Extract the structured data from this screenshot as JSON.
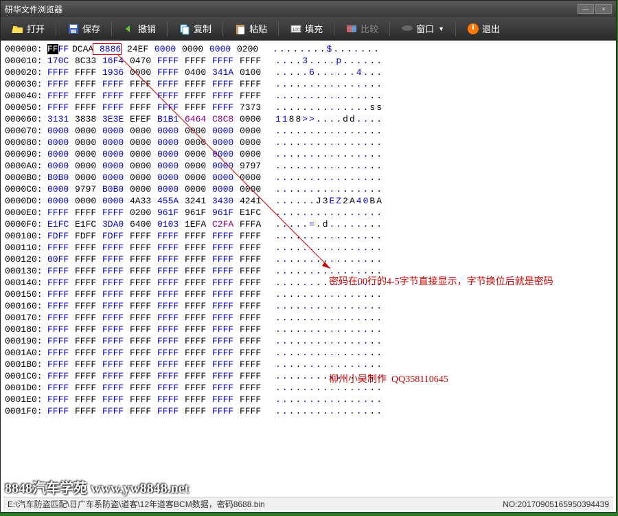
{
  "title": "研华文件浏览器",
  "toolbar": {
    "open": "打开",
    "save": "保存",
    "undo": "撤销",
    "copy": "复制",
    "paste": "粘贴",
    "fill": "填充",
    "compare": "比较",
    "window": "窗口",
    "exit": "退出"
  },
  "hex_rows": [
    {
      "addr": "000000:",
      "bytes": [
        "FFFF",
        "DCAA",
        "8886",
        "24EF",
        "0000",
        "0000",
        "0000",
        "0200"
      ],
      "ascii": "........$......."
    },
    {
      "addr": "000010:",
      "bytes": [
        "170C",
        "8C33",
        "16F4",
        "0470",
        "FFFF",
        "FFFF",
        "FFFF",
        "FFFF"
      ],
      "ascii": "....3....p......"
    },
    {
      "addr": "000020:",
      "bytes": [
        "FFFF",
        "FFFF",
        "1936",
        "0000",
        "FFFF",
        "0400",
        "341A",
        "0100"
      ],
      "ascii": ".....6......4..."
    },
    {
      "addr": "000030:",
      "bytes": [
        "FFFF",
        "FFFF",
        "FFFF",
        "FFFF",
        "FFFF",
        "FFFF",
        "FFFF",
        "FFFF"
      ],
      "ascii": "................"
    },
    {
      "addr": "000040:",
      "bytes": [
        "FFFF",
        "FFFF",
        "FFFF",
        "FFFF",
        "FFFF",
        "FFFF",
        "FFFF",
        "FFFF"
      ],
      "ascii": "................"
    },
    {
      "addr": "000050:",
      "bytes": [
        "FFFF",
        "FFFF",
        "FFFF",
        "FFFF",
        "FFFF",
        "FFFF",
        "FFFF",
        "7373"
      ],
      "ascii": "..............ss"
    },
    {
      "addr": "000060:",
      "bytes": [
        "3131",
        "3838",
        "3E3E",
        "EFEF",
        "B1B1",
        "6464",
        "C8C8",
        "0000"
      ],
      "ascii": "1188>>....dd...."
    },
    {
      "addr": "000070:",
      "bytes": [
        "0000",
        "0000",
        "0000",
        "0000",
        "0000",
        "0000",
        "0000",
        "0000"
      ],
      "ascii": "................"
    },
    {
      "addr": "000080:",
      "bytes": [
        "0000",
        "0000",
        "0000",
        "0000",
        "0000",
        "0000",
        "0000",
        "0000"
      ],
      "ascii": "................"
    },
    {
      "addr": "000090:",
      "bytes": [
        "0000",
        "0000",
        "0000",
        "0000",
        "0000",
        "0000",
        "0000",
        "0000"
      ],
      "ascii": "................"
    },
    {
      "addr": "0000A0:",
      "bytes": [
        "0000",
        "0000",
        "0000",
        "0000",
        "0000",
        "0000",
        "0000",
        "9797"
      ],
      "ascii": "................"
    },
    {
      "addr": "0000B0:",
      "bytes": [
        "B0B0",
        "0000",
        "0000",
        "0000",
        "0000",
        "0000",
        "0000",
        "0000"
      ],
      "ascii": "................"
    },
    {
      "addr": "0000C0:",
      "bytes": [
        "0000",
        "9797",
        "B0B0",
        "0000",
        "0000",
        "0000",
        "0000",
        "0000"
      ],
      "ascii": "................"
    },
    {
      "addr": "0000D0:",
      "bytes": [
        "0000",
        "0000",
        "0000",
        "4A33",
        "455A",
        "3241",
        "3430",
        "4241"
      ],
      "ascii": "......J3EZ2A40BA"
    },
    {
      "addr": "0000E0:",
      "bytes": [
        "FFFF",
        "FFFF",
        "FFFF",
        "0200",
        "961F",
        "961F",
        "961F",
        "E1FC"
      ],
      "ascii": "................"
    },
    {
      "addr": "0000F0:",
      "bytes": [
        "E1FC",
        "E1FC",
        "3DA0",
        "6400",
        "0103",
        "1EFA",
        "C2FA",
        "FFFA"
      ],
      "ascii": ".....=.d........"
    },
    {
      "addr": "000100:",
      "bytes": [
        "FDFF",
        "FDFF",
        "FDFF",
        "FFFF",
        "FFFF",
        "FFFF",
        "FFFF",
        "FFFF"
      ],
      "ascii": "................"
    },
    {
      "addr": "000110:",
      "bytes": [
        "FFFF",
        "FFFF",
        "FFFF",
        "FFFF",
        "FFFF",
        "FFFF",
        "FFFF",
        "FFFF"
      ],
      "ascii": "................"
    },
    {
      "addr": "000120:",
      "bytes": [
        "00FF",
        "FFFF",
        "FFFF",
        "FFFF",
        "FFFF",
        "FFFF",
        "FFFF",
        "FFFF"
      ],
      "ascii": "................"
    },
    {
      "addr": "000130:",
      "bytes": [
        "FFFF",
        "FFFF",
        "FFFF",
        "FFFF",
        "FFFF",
        "FFFF",
        "FFFF",
        "FFFF"
      ],
      "ascii": "................"
    },
    {
      "addr": "000140:",
      "bytes": [
        "FFFF",
        "FFFF",
        "FFFF",
        "FFFF",
        "FFFF",
        "FFFF",
        "FFFF",
        "FFFF"
      ],
      "ascii": "................"
    },
    {
      "addr": "000150:",
      "bytes": [
        "FFFF",
        "FFFF",
        "FFFF",
        "FFFF",
        "FFFF",
        "FFFF",
        "FFFF",
        "FFFF"
      ],
      "ascii": "................"
    },
    {
      "addr": "000160:",
      "bytes": [
        "FFFF",
        "FFFF",
        "FFFF",
        "FFFF",
        "FFFF",
        "FFFF",
        "FFFF",
        "FFFF"
      ],
      "ascii": "................"
    },
    {
      "addr": "000170:",
      "bytes": [
        "FFFF",
        "FFFF",
        "FFFF",
        "FFFF",
        "FFFF",
        "FFFF",
        "FFFF",
        "FFFF"
      ],
      "ascii": "................"
    },
    {
      "addr": "000180:",
      "bytes": [
        "FFFF",
        "FFFF",
        "FFFF",
        "FFFF",
        "FFFF",
        "FFFF",
        "FFFF",
        "FFFF"
      ],
      "ascii": "................"
    },
    {
      "addr": "000190:",
      "bytes": [
        "FFFF",
        "FFFF",
        "FFFF",
        "FFFF",
        "FFFF",
        "FFFF",
        "FFFF",
        "FFFF"
      ],
      "ascii": "................"
    },
    {
      "addr": "0001A0:",
      "bytes": [
        "FFFF",
        "FFFF",
        "FFFF",
        "FFFF",
        "FFFF",
        "FFFF",
        "FFFF",
        "FFFF"
      ],
      "ascii": "................"
    },
    {
      "addr": "0001B0:",
      "bytes": [
        "FFFF",
        "FFFF",
        "FFFF",
        "FFFF",
        "FFFF",
        "FFFF",
        "FFFF",
        "FFFF"
      ],
      "ascii": "................"
    },
    {
      "addr": "0001C0:",
      "bytes": [
        "FFFF",
        "FFFF",
        "FFFF",
        "FFFF",
        "FFFF",
        "FFFF",
        "FFFF",
        "FFFF"
      ],
      "ascii": "................"
    },
    {
      "addr": "0001D0:",
      "bytes": [
        "FFFF",
        "FFFF",
        "FFFF",
        "FFFF",
        "FFFF",
        "FFFF",
        "FFFF",
        "FFFF"
      ],
      "ascii": "................"
    },
    {
      "addr": "0001E0:",
      "bytes": [
        "FFFF",
        "FFFF",
        "FFFF",
        "FFFF",
        "FFFF",
        "FFFF",
        "FFFF",
        "FFFF"
      ],
      "ascii": "................"
    },
    {
      "addr": "0001F0:",
      "bytes": [
        "FFFF",
        "FFFF",
        "FFFF",
        "FFFF",
        "FFFF",
        "FFFF",
        "FFFF",
        "FFFF"
      ],
      "ascii": "................"
    }
  ],
  "annotations": {
    "a1": "密码在00行的4-5字节直接显示，字节换位后就是密码",
    "a2": "柳州小吴制作  QQ358110645"
  },
  "status": {
    "left": "E:\\汽车防盗匹配\\日广车系防盗\\道客\\12年道客BCM数据，密码8688.bin",
    "right": "NO:20170905165950394439"
  },
  "watermark": "8848汽车学苑  www.yw8848.net"
}
